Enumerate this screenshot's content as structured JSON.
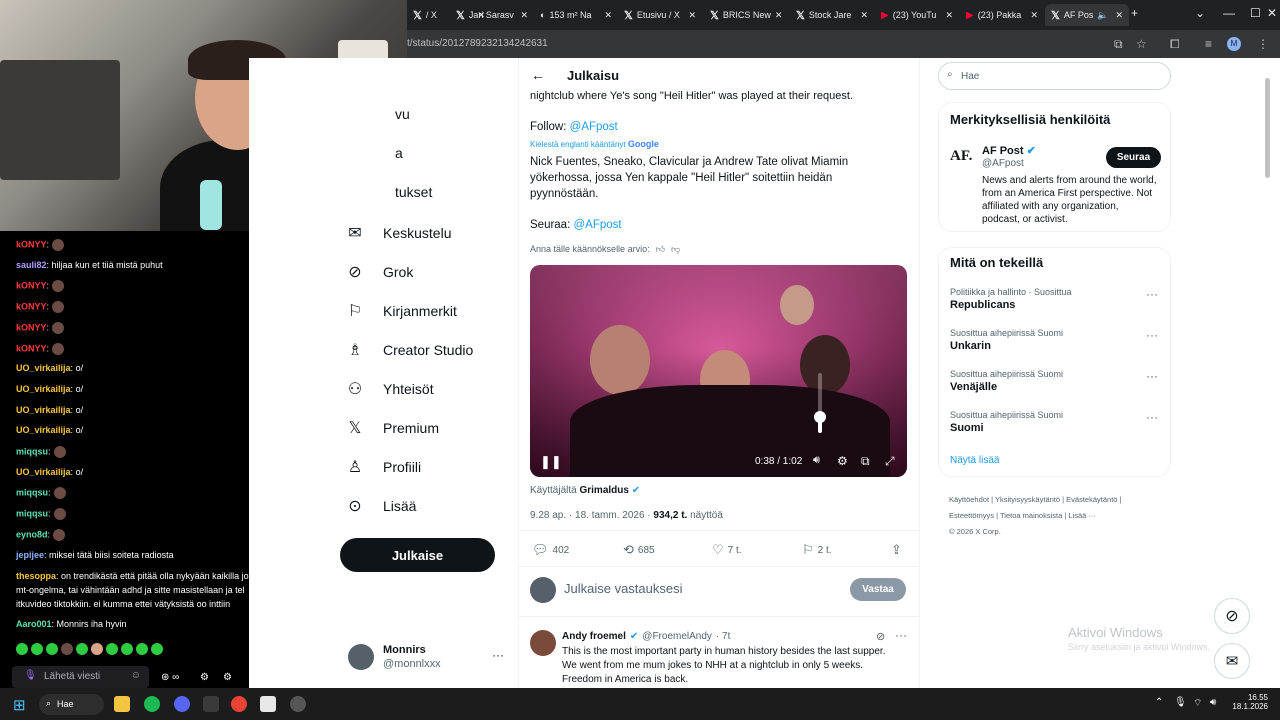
{
  "browser": {
    "tabs": [
      {
        "title": "/ X",
        "icon": "x-logo"
      },
      {
        "title": "Jari Sarasv",
        "icon": "x-logo"
      },
      {
        "title": "153 m² Na",
        "icon": "site-logo"
      },
      {
        "title": "Etusivu / X",
        "icon": "x-logo"
      },
      {
        "title": "BRICS New",
        "icon": "x-logo"
      },
      {
        "title": "Stock Jare",
        "icon": "x-logo"
      },
      {
        "title": "(23) YouTu",
        "icon": "youtube-logo"
      },
      {
        "title": "(23) Pakka",
        "icon": "youtube-logo"
      },
      {
        "title": "AF Pos",
        "icon": "x-logo"
      }
    ],
    "url": "t/status/2012789232134242631",
    "new_tab": "+"
  },
  "chat": {
    "messages": [
      {
        "user": "kONYY",
        "text": "",
        "color": "#ff3b3b",
        "emote": true
      },
      {
        "user": "sauli82",
        "text": "hiljaa kun et tiiä mistä puhut",
        "color": "#b19cff",
        "emote": false
      },
      {
        "user": "kONYY",
        "text": "",
        "color": "#ff3b3b",
        "emote": true
      },
      {
        "user": "kONYY",
        "text": "",
        "color": "#ff3b3b",
        "emote": true
      },
      {
        "user": "kONYY",
        "text": "",
        "color": "#ff3b3b",
        "emote": true
      },
      {
        "user": "kONYY",
        "text": "",
        "color": "#ff3b3b",
        "emote": true
      },
      {
        "user": "UO_virkailija",
        "text": "o/",
        "color": "#f5c542",
        "emote": false
      },
      {
        "user": "UO_virkailija",
        "text": "o/",
        "color": "#f5c542",
        "emote": false
      },
      {
        "user": "UO_virkailija",
        "text": "o/",
        "color": "#f5c542",
        "emote": false
      },
      {
        "user": "UO_virkailija",
        "text": "o/",
        "color": "#f5c542",
        "emote": false
      },
      {
        "user": "miqqsu",
        "text": "",
        "color": "#5ee1b5",
        "emote": true
      },
      {
        "user": "UO_virkailija",
        "text": "o/",
        "color": "#f5c542",
        "emote": false
      },
      {
        "user": "miqqsu",
        "text": "",
        "color": "#5ee1b5",
        "emote": true
      },
      {
        "user": "miqqsu",
        "text": "",
        "color": "#5ee1b5",
        "emote": true
      },
      {
        "user": "eyno8d",
        "text": "",
        "color": "#5ee1b5",
        "emote": true
      },
      {
        "user": "jepijee",
        "text": "miksei tätä biisi soiteta radiosta",
        "color": "#8ab4ff",
        "emote": false
      }
    ],
    "long_message": {
      "user": "thesoppa",
      "lines": [
        ": on trendikästä että pitää olla nykyään kaikilla jo",
        "mt-ongelma, tai vähintään adhd ja sitte masistellaan ja tel",
        "itkuvideo tiktokkiin. ei kumma ettei vätyksistä oo inttiin"
      ],
      "color": "#f5c542"
    },
    "last": {
      "user": "Aaro001",
      "text": ": Monnirs iha hyvin",
      "color": "#5ee1b5"
    },
    "input_placeholder": "Lähetä viesti"
  },
  "nav": {
    "items": [
      {
        "label": "vu",
        "icon": "home-icon"
      },
      {
        "label": "a",
        "icon": "explore-icon"
      },
      {
        "label": "tukset",
        "icon": "bell-icon"
      },
      {
        "label": "Keskustelu",
        "icon": "mail-icon"
      },
      {
        "label": "Grok",
        "icon": "grok-icon"
      },
      {
        "label": "Kirjanmerkit",
        "icon": "bookmark-icon"
      },
      {
        "label": "Creator Studio",
        "icon": "creator-icon"
      },
      {
        "label": "Yhteisöt",
        "icon": "communities-icon"
      },
      {
        "label": "Premium",
        "icon": "x-premium-icon"
      },
      {
        "label": "Profiili",
        "icon": "person-icon"
      },
      {
        "label": "Lisää",
        "icon": "more-circle-icon"
      }
    ],
    "post_button": "Julkaise",
    "account": {
      "name": "Monnirs",
      "handle": "@monnlxxx"
    }
  },
  "post": {
    "header_title": "Julkaisu",
    "text_cut": "nightclub where Ye's song \"Heil Hitler\" was played at their request.",
    "follow_label": "Follow:",
    "follow_handle": "@AFpost",
    "translated_note": "Kielestä englanti kääntänyt",
    "translated_by": "Google",
    "translation_text": "Nick Fuentes, Sneako, Clavicular ja Andrew Tate olivat Miamin yökerhossa, jossa Yen kappale \"Heil Hitler\" soitettiin heidän pyynnöstään.",
    "follow_fi_label": "Seuraa:",
    "follow_fi_handle": "@AFpost",
    "rate_translation": "Anna tälle käännökselle arvio:",
    "video_time": "0:38 / 1:02",
    "video_progress": 0.61,
    "volume_level": 0.3,
    "video_by_label": "Käyttäjältä",
    "video_by_user": "Grimaldus",
    "meta_time": "9.28 ap. · 18. tamm. 2026 ·",
    "meta_views": "934,2 t.",
    "meta_views_label": "näyttöä",
    "stats": {
      "replies": "402",
      "reposts": "685",
      "likes": "7 t.",
      "bookmarks": "2 t."
    },
    "reply_placeholder": "Julkaise vastauksesi",
    "reply_button": "Vastaa"
  },
  "reply": {
    "name": "Andy froemel",
    "handle": "@FroemelAndy",
    "time": "· 7t",
    "text_lines": [
      "This is the most important party in human history besides the last supper.",
      "We went from me mum jokes to NHH at a nightclub in only 5 weeks.",
      "Freedom in America is back."
    ]
  },
  "sidebar": {
    "search_placeholder": "Hae",
    "people_title": "Merkityksellisiä henkilöitä",
    "person": {
      "name": "AF Post",
      "handle": "@AFpost",
      "logo": "AF.",
      "follow": "Seuraa",
      "bio": "News and alerts from around the world, from an America First perspective. Not affiliated with any organization, podcast, or activist."
    },
    "trends_title": "Mitä on tekeillä",
    "trends": [
      {
        "meta": "Politiikka ja hallinto · Suosittua",
        "name": "Republicans"
      },
      {
        "meta": "Suosittua aihepiirissä Suomi",
        "name": "Unkarin"
      },
      {
        "meta": "Suosittua aihepiirissä Suomi",
        "name": "Venäjälle"
      },
      {
        "meta": "Suosittua aihepiirissä Suomi",
        "name": "Suomi"
      }
    ],
    "show_more": "Näytä lisää",
    "footer": [
      "Käyttöehdot",
      "Yksityisyyskäytäntö",
      "Evästekäytäntö",
      "Esteettömyys",
      "Tietoa mainoksista",
      "Lisää ···",
      "© 2026 X Corp."
    ],
    "watermark_title": "Aktivoi Windows",
    "watermark_sub": "Siirry asetuksiin ja aktivoi Windows."
  },
  "taskbar": {
    "search": "Hae",
    "time": "16.55",
    "date": "18.1.2026"
  },
  "colors": {
    "accent": "#1d9bf0",
    "dark": "#0f1419",
    "muted": "#536471"
  }
}
